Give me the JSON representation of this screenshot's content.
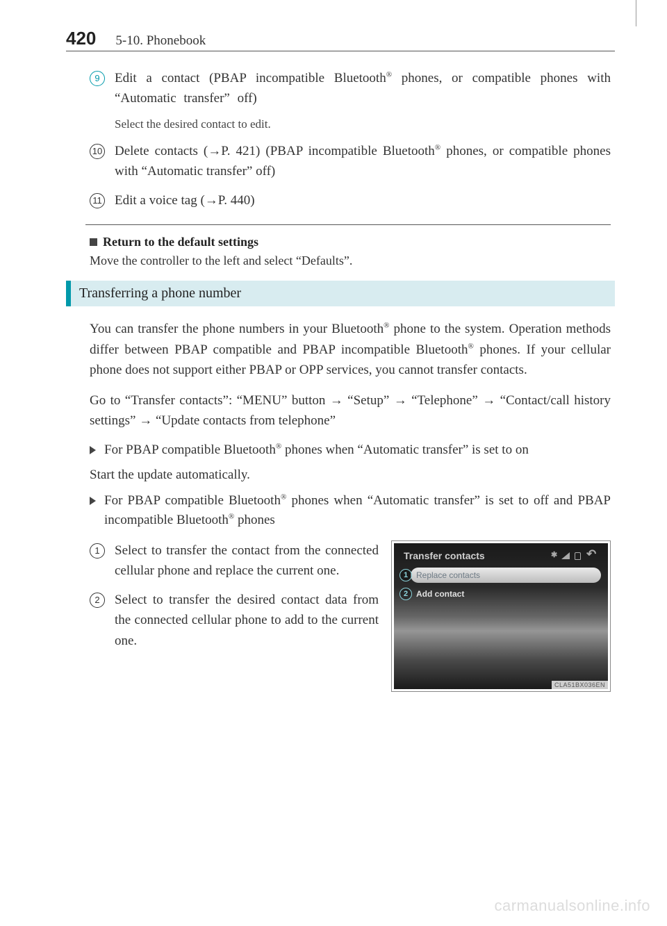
{
  "header": {
    "page_number": "420",
    "section": "5-10. Phonebook"
  },
  "items": {
    "n9": {
      "num": "9",
      "text_before_sup": "Edit a contact (PBAP incompatible Bluetooth",
      "sup": "®",
      "text_after_sup": " phones, or compatible phones with “Automatic transfer” off)",
      "sub": "Select the desired contact to edit."
    },
    "n10": {
      "num": "10",
      "a": "Delete contacts (",
      "arrow": "→",
      "b": "P. 421) (PBAP incompatible Bluetooth",
      "sup": "®",
      "c": " phones, or compatible phones with “Automatic transfer” off)"
    },
    "n11": {
      "num": "11",
      "a": "Edit a voice tag (",
      "arrow": "→",
      "b": "P. 440)"
    }
  },
  "defaults": {
    "title": "Return to the default settings",
    "body": "Move the controller to the left and select “Defaults”."
  },
  "banner": "Transferring a phone number",
  "transfer": {
    "p1a": "You can transfer the phone numbers in your Bluetooth",
    "p1sup1": "®",
    "p1b": " phone to the system. Operation methods differ between PBAP compatible and PBAP incompatible Bluetooth",
    "p1sup2": "®",
    "p1c": " phones. If your cellular phone does not support either PBAP or OPP services, you cannot transfer contacts.",
    "p2a": "Go to “Transfer contacts”: “MENU” button ",
    "arr": "→",
    "p2b": " “Setup” ",
    "p2c": " “Telephone” ",
    "p2d": " “Contact/call history settings” ",
    "p2e": " “Update contacts from telephone”"
  },
  "bullets": {
    "b1a": "For PBAP compatible Bluetooth",
    "b1sup": "®",
    "b1b": " phones when “Automatic transfer” is set to on",
    "b1body": "Start the update automatically.",
    "b2a": "For PBAP compatible Bluetooth",
    "b2sup1": "®",
    "b2b": " phones when “Automatic transfer” is set to off and PBAP incompatible Bluetooth",
    "b2sup2": "®",
    "b2c": " phones"
  },
  "steps": {
    "s1": {
      "num": "1",
      "text": "Select to transfer the contact from the connected cellular phone and replace the current one."
    },
    "s2": {
      "num": "2",
      "text": "Select to transfer the desired contact data from the connected cellular phone to add to the current one."
    }
  },
  "screen": {
    "title": "Transfer contacts",
    "row1": {
      "callout": "1",
      "label": "Replace contacts"
    },
    "row2": {
      "callout": "2",
      "label": "Add contact"
    },
    "code": "CLA51BX036EN"
  },
  "watermark": "carmanualsonline.info"
}
